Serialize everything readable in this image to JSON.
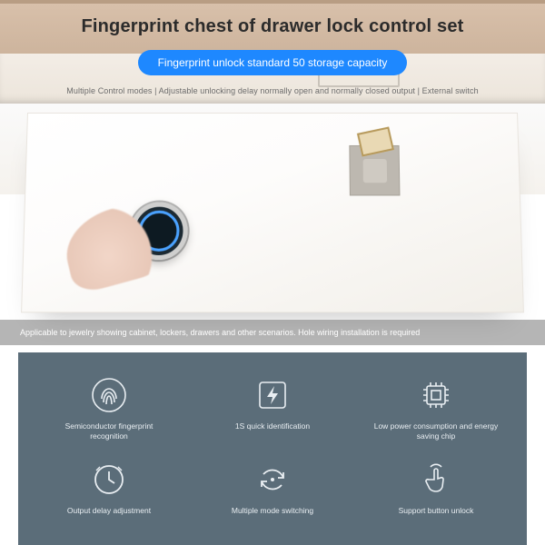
{
  "hero": {
    "title": "Fingerprint chest of drawer lock control set",
    "pill": "Fingerprint unlock standard 50 storage capacity",
    "subline": "Multiple Control modes | Adjustable unlocking delay normally open and normally closed output | External switch",
    "caption": "Applicable to jewelry showing cabinet, lockers, drawers and other scenarios. Hole wiring installation is required"
  },
  "features": [
    {
      "label": "Semiconductor fingerprint recognition",
      "icon": "fingerprint"
    },
    {
      "label": "1S quick identification",
      "icon": "bolt"
    },
    {
      "label": "Low power consumption and energy saving chip",
      "icon": "chip"
    },
    {
      "label": "Output delay adjustment",
      "icon": "clock"
    },
    {
      "label": "Multiple mode switching",
      "icon": "cycle"
    },
    {
      "label": "Support button unlock",
      "icon": "touch"
    }
  ],
  "colors": {
    "accent": "#1e88ff",
    "panel": "#5b6d79"
  }
}
